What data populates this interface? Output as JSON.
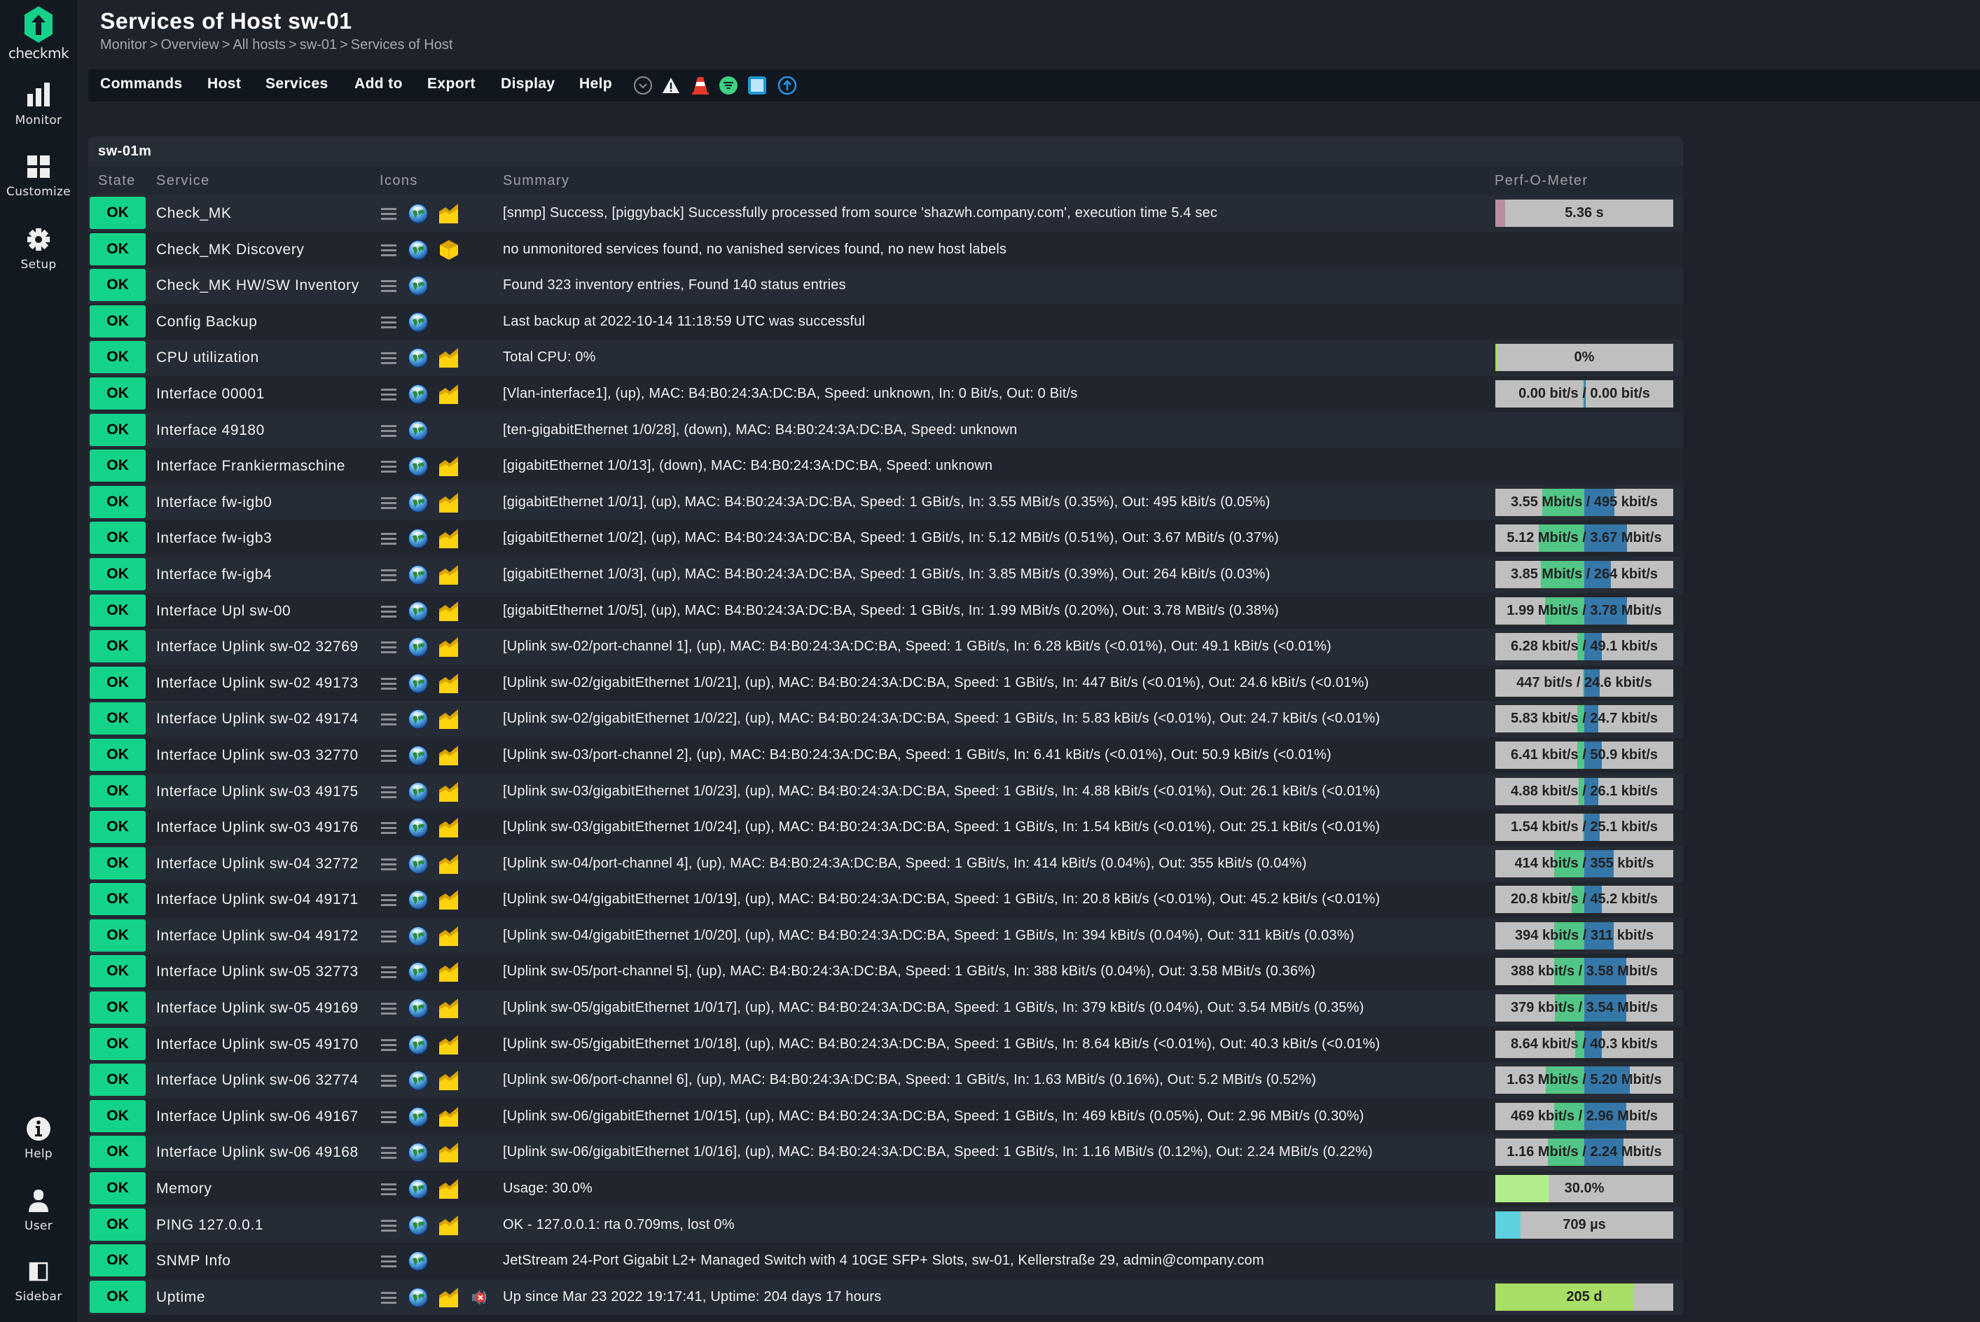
{
  "app": {
    "logo_text": "checkmk"
  },
  "sidebar": {
    "top": [
      {
        "id": "monitor",
        "label": "Monitor",
        "icon": "monitor-icon"
      },
      {
        "id": "customize",
        "label": "Customize",
        "icon": "customize-icon"
      },
      {
        "id": "setup",
        "label": "Setup",
        "icon": "gear-icon"
      }
    ],
    "bottom": [
      {
        "id": "help",
        "label": "Help",
        "icon": "info-icon"
      },
      {
        "id": "user",
        "label": "User",
        "icon": "user-icon"
      },
      {
        "id": "sidebar",
        "label": "Sidebar",
        "icon": "sidebar-toggle-icon"
      }
    ]
  },
  "header": {
    "title": "Services of Host sw-01",
    "breadcrumb": [
      "Monitor",
      "Overview",
      "All hosts",
      "sw-01",
      "Services of Host"
    ],
    "breadcrumb_sep": ">"
  },
  "menubar": {
    "items": [
      "Commands",
      "Host",
      "Services",
      "Add to",
      "Export",
      "Display",
      "Help"
    ],
    "icons": [
      "chevron-down-circle-icon",
      "warning-icon",
      "traffic-cone-icon",
      "filter-icon",
      "checkbox-toggle-icon",
      "upload-arrow-icon"
    ]
  },
  "table": {
    "group": "sw-01m",
    "columns": {
      "state": "State",
      "service": "Service",
      "icons": "Icons",
      "summary": "Summary",
      "perf": "Perf-O-Meter"
    },
    "colors": {
      "ok": "#13d389",
      "perf_in": "#52c686",
      "perf_out": "#3577a8",
      "perf_bg": "#bfbfbf"
    },
    "rows": [
      {
        "state": "OK",
        "service": "Check_MK",
        "icons": [
          "menu",
          "globe",
          "graph"
        ],
        "summary": "[snmp] Success, [piggyback] Successfully processed from source 'shazwh.company.com', execution time 5.4 sec",
        "perf": {
          "type": "single",
          "label": "5.36 s",
          "fill": 0.055,
          "color": "#b98ea3"
        }
      },
      {
        "state": "OK",
        "service": "Check_MK Discovery",
        "icons": [
          "menu",
          "globe",
          "box"
        ],
        "summary": "no unmonitored services found, no vanished services found, no new host labels",
        "perf": null
      },
      {
        "state": "OK",
        "service": "Check_MK HW/SW Inventory",
        "icons": [
          "menu",
          "globe"
        ],
        "summary": "Found 323 inventory entries, Found 140 status entries",
        "perf": null
      },
      {
        "state": "OK",
        "service": "Config Backup",
        "icons": [
          "menu",
          "globe"
        ],
        "summary": "Last backup at 2022-10-14 11:18:59 UTC was successful",
        "perf": null
      },
      {
        "state": "OK",
        "service": "CPU utilization",
        "icons": [
          "menu",
          "globe",
          "graph"
        ],
        "summary": "Total CPU: 0%",
        "perf": {
          "type": "single",
          "label": "0%",
          "fill": 0.0,
          "color": "#a6dd5e"
        }
      },
      {
        "state": "OK",
        "service": "Interface 00001",
        "icons": [
          "menu",
          "globe",
          "graph"
        ],
        "summary": "[Vlan-interface1], (up), MAC: B4:B0:24:3A:DC:BA, Speed: unknown, In: 0 Bit/s, Out: 0 Bit/s",
        "perf": {
          "type": "dual",
          "label": "0.00 bit/s / 0.00 bit/s",
          "in": 0.0,
          "out": 0.0
        }
      },
      {
        "state": "OK",
        "service": "Interface 49180",
        "icons": [
          "menu",
          "globe"
        ],
        "summary": "[ten-gigabitEthernet 1/0/28], (down), MAC: B4:B0:24:3A:DC:BA, Speed: unknown",
        "perf": null
      },
      {
        "state": "OK",
        "service": "Interface Frankiermaschine",
        "icons": [
          "menu",
          "globe",
          "graph"
        ],
        "summary": "[gigabitEthernet 1/0/13], (down), MAC: B4:B0:24:3A:DC:BA, Speed: unknown",
        "perf": null
      },
      {
        "state": "OK",
        "service": "Interface fw-igb0",
        "icons": [
          "menu",
          "globe",
          "graph"
        ],
        "summary": "[gigabitEthernet 1/0/1], (up), MAC: B4:B0:24:3A:DC:BA, Speed: 1 GBit/s, In: 3.55 MBit/s (0.35%), Out: 495 kBit/s (0.05%)",
        "perf": {
          "type": "dual",
          "label": "3.55 Mbit/s / 495 kbit/s",
          "in": 0.47,
          "out": 0.34
        }
      },
      {
        "state": "OK",
        "service": "Interface fw-igb3",
        "icons": [
          "menu",
          "globe",
          "graph"
        ],
        "summary": "[gigabitEthernet 1/0/2], (up), MAC: B4:B0:24:3A:DC:BA, Speed: 1 GBit/s, In: 5.12 MBit/s (0.51%), Out: 3.67 MBit/s (0.37%)",
        "perf": {
          "type": "dual",
          "label": "5.12 Mbit/s / 3.67 Mbit/s",
          "in": 0.51,
          "out": 0.48
        }
      },
      {
        "state": "OK",
        "service": "Interface fw-igb4",
        "icons": [
          "menu",
          "globe",
          "graph"
        ],
        "summary": "[gigabitEthernet 1/0/3], (up), MAC: B4:B0:24:3A:DC:BA, Speed: 1 GBit/s, In: 3.85 MBit/s (0.39%), Out: 264 kBit/s (0.03%)",
        "perf": {
          "type": "dual",
          "label": "3.85 Mbit/s / 264 kbit/s",
          "in": 0.49,
          "out": 0.3
        }
      },
      {
        "state": "OK",
        "service": "Interface Upl sw-00",
        "icons": [
          "menu",
          "globe",
          "graph"
        ],
        "summary": "[gigabitEthernet 1/0/5], (up), MAC: B4:B0:24:3A:DC:BA, Speed: 1 GBit/s, In: 1.99 MBit/s (0.20%), Out: 3.78 MBit/s (0.38%)",
        "perf": {
          "type": "dual",
          "label": "1.99 Mbit/s / 3.78 Mbit/s",
          "in": 0.44,
          "out": 0.48
        }
      },
      {
        "state": "OK",
        "service": "Interface Uplink sw-02 32769",
        "icons": [
          "menu",
          "globe",
          "graph"
        ],
        "summary": "[Uplink sw-02/port-channel 1], (up), MAC: B4:B0:24:3A:DC:BA, Speed: 1 GBit/s, In: 6.28 kBit/s (<0.01%), Out: 49.1 kBit/s (<0.01%)",
        "perf": {
          "type": "dual",
          "label": "6.28 kbit/s / 49.1 kbit/s",
          "in": 0.08,
          "out": 0.2
        }
      },
      {
        "state": "OK",
        "service": "Interface Uplink sw-02 49173",
        "icons": [
          "menu",
          "globe",
          "graph"
        ],
        "summary": "[Uplink sw-02/gigabitEthernet 1/0/21], (up), MAC: B4:B0:24:3A:DC:BA, Speed: 1 GBit/s, In: 447 Bit/s (<0.01%), Out: 24.6 kBit/s (<0.01%)",
        "perf": {
          "type": "dual",
          "label": "447 bit/s / 24.6 kbit/s",
          "in": 0.01,
          "out": 0.17
        }
      },
      {
        "state": "OK",
        "service": "Interface Uplink sw-02 49174",
        "icons": [
          "menu",
          "globe",
          "graph"
        ],
        "summary": "[Uplink sw-02/gigabitEthernet 1/0/22], (up), MAC: B4:B0:24:3A:DC:BA, Speed: 1 GBit/s, In: 5.83 kBit/s (<0.01%), Out: 24.7 kBit/s (<0.01%)",
        "perf": {
          "type": "dual",
          "label": "5.83 kbit/s / 24.7 kbit/s",
          "in": 0.08,
          "out": 0.16
        }
      },
      {
        "state": "OK",
        "service": "Interface Uplink sw-03 32770",
        "icons": [
          "menu",
          "globe",
          "graph"
        ],
        "summary": "[Uplink sw-03/port-channel 2], (up), MAC: B4:B0:24:3A:DC:BA, Speed: 1 GBit/s, In: 6.41 kBit/s (<0.01%), Out: 50.9 kBit/s (<0.01%)",
        "perf": {
          "type": "dual",
          "label": "6.41 kbit/s / 50.9 kbit/s",
          "in": 0.08,
          "out": 0.2
        }
      },
      {
        "state": "OK",
        "service": "Interface Uplink sw-03 49175",
        "icons": [
          "menu",
          "globe",
          "graph"
        ],
        "summary": "[Uplink sw-03/gigabitEthernet 1/0/23], (up), MAC: B4:B0:24:3A:DC:BA, Speed: 1 GBit/s, In: 4.88 kBit/s (<0.01%), Out: 26.1 kBit/s (<0.01%)",
        "perf": {
          "type": "dual",
          "label": "4.88 kbit/s / 26.1 kbit/s",
          "in": 0.06,
          "out": 0.16
        }
      },
      {
        "state": "OK",
        "service": "Interface Uplink sw-03 49176",
        "icons": [
          "menu",
          "globe",
          "graph"
        ],
        "summary": "[Uplink sw-03/gigabitEthernet 1/0/24], (up), MAC: B4:B0:24:3A:DC:BA, Speed: 1 GBit/s, In: 1.54 kBit/s (<0.01%), Out: 25.1 kBit/s (<0.01%)",
        "perf": {
          "type": "dual",
          "label": "1.54 kbit/s / 25.1 kbit/s",
          "in": 0.01,
          "out": 0.17
        }
      },
      {
        "state": "OK",
        "service": "Interface Uplink sw-04 32772",
        "icons": [
          "menu",
          "globe",
          "graph"
        ],
        "summary": "[Uplink sw-04/port-channel 4], (up), MAC: B4:B0:24:3A:DC:BA, Speed: 1 GBit/s, In: 414 kBit/s (0.04%), Out: 355 kBit/s (0.04%)",
        "perf": {
          "type": "dual",
          "label": "414 kbit/s / 355 kbit/s",
          "in": 0.34,
          "out": 0.33
        }
      },
      {
        "state": "OK",
        "service": "Interface Uplink sw-04 49171",
        "icons": [
          "menu",
          "globe",
          "graph"
        ],
        "summary": "[Uplink sw-04/gigabitEthernet 1/0/19], (up), MAC: B4:B0:24:3A:DC:BA, Speed: 1 GBit/s, In: 20.8 kBit/s (<0.01%), Out: 45.2 kBit/s (<0.01%)",
        "perf": {
          "type": "dual",
          "label": "20.8 kbit/s / 45.2 kbit/s",
          "in": 0.14,
          "out": 0.2
        }
      },
      {
        "state": "OK",
        "service": "Interface Uplink sw-04 49172",
        "icons": [
          "menu",
          "globe",
          "graph"
        ],
        "summary": "[Uplink sw-04/gigabitEthernet 1/0/20], (up), MAC: B4:B0:24:3A:DC:BA, Speed: 1 GBit/s, In: 394 kBit/s (0.04%), Out: 311 kBit/s (0.03%)",
        "perf": {
          "type": "dual",
          "label": "394 kbit/s / 311 kbit/s",
          "in": 0.34,
          "out": 0.33
        }
      },
      {
        "state": "OK",
        "service": "Interface Uplink sw-05 32773",
        "icons": [
          "menu",
          "globe",
          "graph"
        ],
        "summary": "[Uplink sw-05/port-channel 5], (up), MAC: B4:B0:24:3A:DC:BA, Speed: 1 GBit/s, In: 388 kBit/s (0.04%), Out: 3.58 MBit/s (0.36%)",
        "perf": {
          "type": "dual",
          "label": "388 kbit/s / 3.58 Mbit/s",
          "in": 0.34,
          "out": 0.47
        }
      },
      {
        "state": "OK",
        "service": "Interface Uplink sw-05 49169",
        "icons": [
          "menu",
          "globe",
          "graph"
        ],
        "summary": "[Uplink sw-05/gigabitEthernet 1/0/17], (up), MAC: B4:B0:24:3A:DC:BA, Speed: 1 GBit/s, In: 379 kBit/s (0.04%), Out: 3.54 MBit/s (0.35%)",
        "perf": {
          "type": "dual",
          "label": "379 kbit/s / 3.54 Mbit/s",
          "in": 0.33,
          "out": 0.47
        }
      },
      {
        "state": "OK",
        "service": "Interface Uplink sw-05 49170",
        "icons": [
          "menu",
          "globe",
          "graph"
        ],
        "summary": "[Uplink sw-05/gigabitEthernet 1/0/18], (up), MAC: B4:B0:24:3A:DC:BA, Speed: 1 GBit/s, In: 8.64 kBit/s (<0.01%), Out: 40.3 kBit/s (<0.01%)",
        "perf": {
          "type": "dual",
          "label": "8.64 kbit/s / 40.3 kbit/s",
          "in": 0.1,
          "out": 0.2
        }
      },
      {
        "state": "OK",
        "service": "Interface Uplink sw-06 32774",
        "icons": [
          "menu",
          "globe",
          "graph"
        ],
        "summary": "[Uplink sw-06/port-channel 6], (up), MAC: B4:B0:24:3A:DC:BA, Speed: 1 GBit/s, In: 1.63 MBit/s (0.16%), Out: 5.2 MBit/s (0.52%)",
        "perf": {
          "type": "dual",
          "label": "1.63 Mbit/s / 5.20 Mbit/s",
          "in": 0.43,
          "out": 0.51
        }
      },
      {
        "state": "OK",
        "service": "Interface Uplink sw-06 49167",
        "icons": [
          "menu",
          "globe",
          "graph"
        ],
        "summary": "[Uplink sw-06/gigabitEthernet 1/0/15], (up), MAC: B4:B0:24:3A:DC:BA, Speed: 1 GBit/s, In: 469 kBit/s (0.05%), Out: 2.96 MBit/s (0.30%)",
        "perf": {
          "type": "dual",
          "label": "469 kbit/s / 2.96 Mbit/s",
          "in": 0.34,
          "out": 0.47
        }
      },
      {
        "state": "OK",
        "service": "Interface Uplink sw-06 49168",
        "icons": [
          "menu",
          "globe",
          "graph"
        ],
        "summary": "[Uplink sw-06/gigabitEthernet 1/0/16], (up), MAC: B4:B0:24:3A:DC:BA, Speed: 1 GBit/s, In: 1.16 MBit/s (0.12%), Out: 2.24 MBit/s (0.22%)",
        "perf": {
          "type": "dual",
          "label": "1.16 Mbit/s / 2.24 Mbit/s",
          "in": 0.41,
          "out": 0.44
        }
      },
      {
        "state": "OK",
        "service": "Memory",
        "icons": [
          "menu",
          "globe",
          "graph"
        ],
        "summary": "Usage: 30.0%",
        "perf": {
          "type": "single",
          "label": "30.0%",
          "fill": 0.3,
          "color": "#b0ed8c"
        }
      },
      {
        "state": "OK",
        "service": "PING 127.0.0.1",
        "icons": [
          "menu",
          "globe",
          "graph"
        ],
        "summary": "OK - 127.0.0.1: rta 0.709ms, lost 0%",
        "perf": {
          "type": "single",
          "label": "709 µs",
          "fill": 0.14,
          "color": "#5ed1de"
        }
      },
      {
        "state": "OK",
        "service": "SNMP Info",
        "icons": [
          "menu",
          "globe"
        ],
        "summary": "JetStream 24-Port Gigabit L2+ Managed Switch with 4 10GE SFP+ Slots, sw-01, Kellerstraße 29, admin@company.com",
        "perf": null
      },
      {
        "state": "OK",
        "service": "Uptime",
        "icons": [
          "menu",
          "globe",
          "graph",
          "muted"
        ],
        "summary": "Up since Mar 23 2022 19:17:41, Uptime: 204 days 17 hours",
        "perf": {
          "type": "single",
          "label": "205 d",
          "fill": 0.78,
          "color": "#a8dd66"
        }
      }
    ]
  }
}
